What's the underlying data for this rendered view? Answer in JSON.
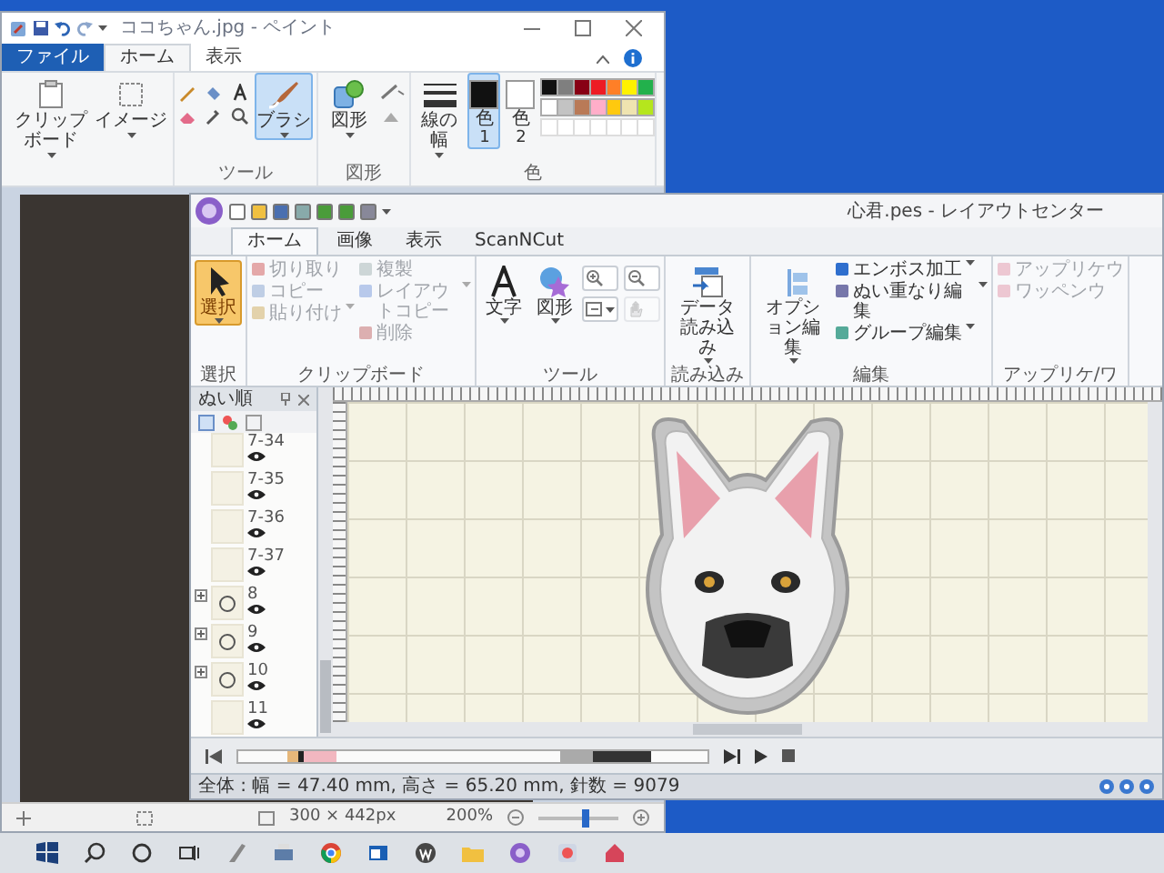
{
  "paint": {
    "title": "ココちゃん.jpg - ペイント",
    "tabs": [
      {
        "label": "ファイル",
        "kind": "file",
        "selected": false
      },
      {
        "label": "ホーム",
        "kind": "tab",
        "selected": true
      },
      {
        "label": "表示",
        "kind": "tab",
        "selected": false
      }
    ],
    "buttons": [
      {
        "label": "クリップボード",
        "selected": false
      },
      {
        "label": "イメージ",
        "selected": false
      },
      {
        "label": "ブラシ",
        "selected": true
      },
      {
        "label": "図形",
        "selected": false
      },
      {
        "label": "線の幅",
        "selected": false
      }
    ],
    "colors": [
      {
        "label": "色",
        "number": "1",
        "selected": true,
        "color": "#111111"
      },
      {
        "label": "色",
        "number": "2",
        "selected": false,
        "color": "#ffffff"
      }
    ],
    "palette": [
      {
        "color": "#111111"
      },
      {
        "color": "#7f7f7f"
      },
      {
        "color": "#880015"
      },
      {
        "color": "#ed1c24"
      },
      {
        "color": "#ff7f27"
      },
      {
        "color": "#fff200"
      },
      {
        "color": "#22b14c"
      },
      {
        "color": "#ffffff"
      },
      {
        "color": "#c3c3c3"
      },
      {
        "color": "#b97a57"
      },
      {
        "color": "#ffaec9"
      },
      {
        "color": "#ffc90e"
      },
      {
        "color": "#efe4b0"
      },
      {
        "color": "#b5e61d"
      }
    ],
    "groups": [
      "ツール",
      "図形",
      "色"
    ],
    "status": {
      "size": "300 × 442px",
      "zoom": "200%",
      "level": 0.6
    }
  },
  "layout_center": {
    "title": "心君.pes - レイアウトセンター",
    "tabs": [
      {
        "label": "ホーム",
        "selected": true
      },
      {
        "label": "画像",
        "selected": false
      },
      {
        "label": "表示",
        "selected": false
      },
      {
        "label": "ScanNCut",
        "selected": false
      }
    ],
    "groups": [
      {
        "label": "選択",
        "buttons": [
          {
            "label": "選択",
            "kind": "large",
            "selected": true,
            "disabled": false,
            "dropdown": true
          }
        ]
      },
      {
        "label": "クリップボード",
        "buttons": [
          {
            "label": "切り取り",
            "kind": "small",
            "selected": false,
            "disabled": true,
            "dropdown": false
          },
          {
            "label": "コピー",
            "kind": "small",
            "selected": false,
            "disabled": true,
            "dropdown": false
          },
          {
            "label": "貼り付け",
            "kind": "small",
            "selected": false,
            "disabled": true,
            "dropdown": true
          },
          {
            "label": "複製",
            "kind": "small",
            "selected": false,
            "disabled": true,
            "dropdown": false
          },
          {
            "label": "レイアウトコピー",
            "kind": "small",
            "selected": false,
            "disabled": true,
            "dropdown": true
          },
          {
            "label": "削除",
            "kind": "small",
            "selected": false,
            "disabled": true,
            "dropdown": false
          }
        ]
      },
      {
        "label": "ツール",
        "buttons": [
          {
            "label": "文字",
            "kind": "large",
            "selected": false,
            "disabled": false,
            "dropdown": true
          },
          {
            "label": "図形",
            "kind": "large",
            "selected": false,
            "disabled": false,
            "dropdown": true
          },
          {
            "kind": "icon",
            "selected": false,
            "disabled": false,
            "dropdown": false
          },
          {
            "kind": "icon",
            "selected": false,
            "disabled": false,
            "dropdown": false
          },
          {
            "kind": "icon",
            "selected": false,
            "disabled": false,
            "dropdown": true
          },
          {
            "kind": "icon",
            "selected": false,
            "disabled": true,
            "dropdown": false
          }
        ]
      },
      {
        "label": "読み込み",
        "buttons": [
          {
            "label": "データ読み込み",
            "kind": "large",
            "selected": false,
            "disabled": false,
            "dropdown": true
          }
        ]
      },
      {
        "label": "編集",
        "buttons": [
          {
            "label": "オプション編集",
            "kind": "large",
            "selected": false,
            "disabled": false,
            "dropdown": true
          },
          {
            "label": "エンボス加工",
            "kind": "small",
            "selected": false,
            "disabled": false,
            "dropdown": true
          },
          {
            "label": "ぬい重なり編集",
            "kind": "small",
            "selected": false,
            "disabled": false,
            "dropdown": true
          },
          {
            "label": "グループ編集",
            "kind": "small",
            "selected": false,
            "disabled": false,
            "dropdown": true
          }
        ]
      },
      {
        "label": "アップリケ/ワ",
        "buttons": [
          {
            "label": "アップリケウ",
            "kind": "small",
            "selected": false,
            "disabled": true,
            "dropdown": false
          },
          {
            "label": "ワッペンウ",
            "kind": "small",
            "selected": false,
            "disabled": true,
            "dropdown": false
          }
        ]
      }
    ],
    "stitch_order": {
      "title": "ぬい順",
      "items": [
        {
          "label": "7-34",
          "kind": "part"
        },
        {
          "label": "7-35",
          "kind": "part"
        },
        {
          "label": "7-36",
          "kind": "part"
        },
        {
          "label": "7-37",
          "kind": "part"
        },
        {
          "label": "8",
          "kind": "group"
        },
        {
          "label": "9",
          "kind": "group"
        },
        {
          "label": "10",
          "kind": "group"
        },
        {
          "label": "11",
          "kind": "part"
        }
      ]
    },
    "status": "全体 : 幅 = 47.40 mm, 高さ = 65.20 mm, 針数 = 9079"
  }
}
